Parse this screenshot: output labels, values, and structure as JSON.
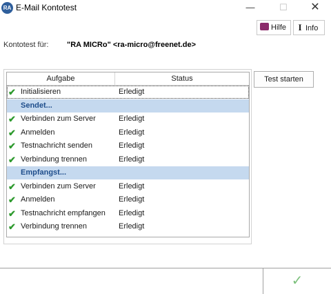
{
  "window": {
    "title": "E-Mail Kontotest",
    "icon": "RA",
    "minimize": "—",
    "maximize": "☐",
    "close": "✕"
  },
  "toolbar": {
    "help_label": "Hilfe",
    "info_label": "Info"
  },
  "account": {
    "label": "Kontotest für:",
    "value": "\"RA MICRo\" <ra-micro@freenet.de>"
  },
  "table": {
    "columns": [
      "Aufgabe",
      "Status"
    ],
    "rows": [
      {
        "type": "item",
        "task": "Initialisieren",
        "status": "Erledigt",
        "selected": true
      },
      {
        "type": "group",
        "label": "Sendet..."
      },
      {
        "type": "item",
        "task": "Verbinden zum Server",
        "status": "Erledigt"
      },
      {
        "type": "item",
        "task": "Anmelden",
        "status": "Erledigt"
      },
      {
        "type": "item",
        "task": "Testnachricht senden",
        "status": "Erledigt"
      },
      {
        "type": "item",
        "task": "Verbindung trennen",
        "status": "Erledigt"
      },
      {
        "type": "group",
        "label": "Empfangst..."
      },
      {
        "type": "item",
        "task": "Verbinden zum Server",
        "status": "Erledigt"
      },
      {
        "type": "item",
        "task": "Anmelden",
        "status": "Erledigt"
      },
      {
        "type": "item",
        "task": "Testnachricht empfangen",
        "status": "Erledigt"
      },
      {
        "type": "item",
        "task": "Verbindung trennen",
        "status": "Erledigt"
      }
    ],
    "check_icon": "✔"
  },
  "actions": {
    "test_label": "Test starten",
    "ok_icon": "✓"
  },
  "colors": {
    "group_bg": "#c5d9ef",
    "group_text": "#1f4e8c",
    "check": "#2e9a2e"
  }
}
